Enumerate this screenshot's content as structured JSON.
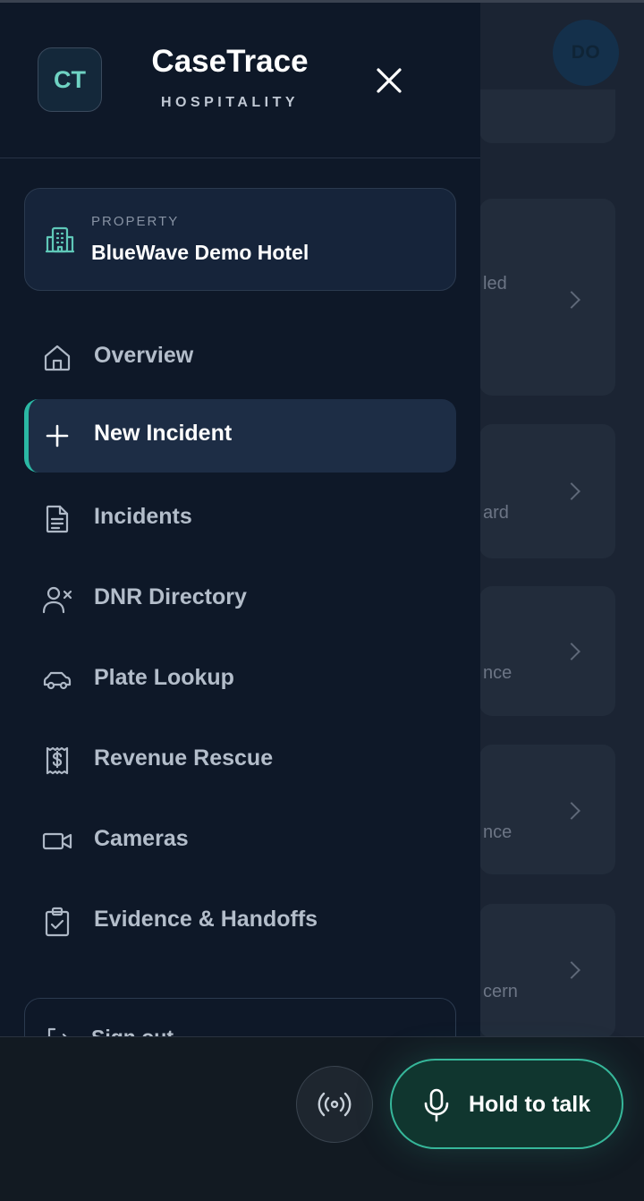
{
  "background": {
    "avatar_initials": "DO",
    "card_fragments": [
      "led",
      "ard",
      "nce",
      "nce",
      "cern"
    ]
  },
  "drawer": {
    "logo_initials": "CT",
    "brand_title": "CaseTrace",
    "brand_subtitle": "HOSPITALITY",
    "property": {
      "label": "PROPERTY",
      "name": "BlueWave Demo Hotel",
      "icon": "building-icon"
    },
    "nav": [
      {
        "label": "Overview",
        "icon": "home-icon",
        "active": false
      },
      {
        "label": "New Incident",
        "icon": "plus-icon",
        "active": true
      },
      {
        "label": "Incidents",
        "icon": "document-icon",
        "active": false
      },
      {
        "label": "DNR Directory",
        "icon": "user-x-icon",
        "active": false
      },
      {
        "label": "Plate Lookup",
        "icon": "car-icon",
        "active": false
      },
      {
        "label": "Revenue Rescue",
        "icon": "receipt-dollar-icon",
        "active": false
      },
      {
        "label": "Cameras",
        "icon": "video-camera-icon",
        "active": false
      },
      {
        "label": "Evidence & Handoffs",
        "icon": "clipboard-check-icon",
        "active": false
      }
    ],
    "sign_out_label": "Sign out"
  },
  "bottom_bar": {
    "talk_label": "Hold to talk"
  },
  "colors": {
    "accent": "#2bb8a4",
    "drawer_bg": "#0e1828",
    "talk_border": "#36b79a"
  }
}
